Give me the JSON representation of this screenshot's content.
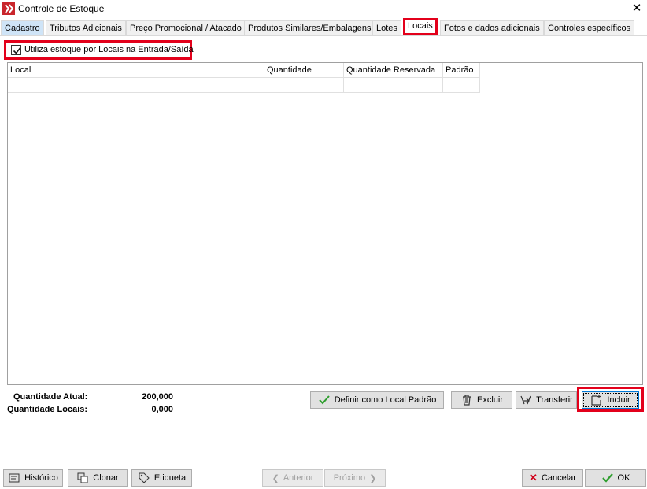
{
  "window": {
    "title": "Controle de Estoque"
  },
  "tabs": [
    {
      "label": "Cadastro"
    },
    {
      "label": "Tributos Adicionais"
    },
    {
      "label": "Preço Promocional / Atacado"
    },
    {
      "label": "Produtos Similares/Embalagens"
    },
    {
      "label": "Lotes"
    },
    {
      "label": "Locais"
    },
    {
      "label": "Fotos e dados adicionais"
    },
    {
      "label": "Controles específicos"
    }
  ],
  "checkbox": {
    "label": "Utiliza estoque por Locais na Entrada/Saída",
    "checked": true
  },
  "grid": {
    "columns": [
      "Local",
      "Quantidade",
      "Quantidade Reservada",
      "Padrão"
    ],
    "rows": []
  },
  "totals": {
    "quantidade_atual_label": "Quantidade Atual:",
    "quantidade_atual_value": "200,000",
    "quantidade_locais_label": "Quantidade Locais:",
    "quantidade_locais_value": "0,000"
  },
  "actions": {
    "definir_label": "Definir como Local Padrão",
    "excluir_label": "Excluir",
    "transferir_label": "Transferir",
    "incluir_label": "Incluir"
  },
  "footer": {
    "historico_label": "Histórico",
    "clonar_label": "Clonar",
    "etiqueta_label": "Etiqueta",
    "anterior_label": "Anterior",
    "proximo_label": "Próximo",
    "cancelar_label": "Cancelar",
    "ok_label": "OK"
  },
  "colors": {
    "highlight": "#e3001b",
    "ok_green": "#2e9e2e",
    "cancel_red": "#d0021b",
    "brand": "#c9262c"
  }
}
